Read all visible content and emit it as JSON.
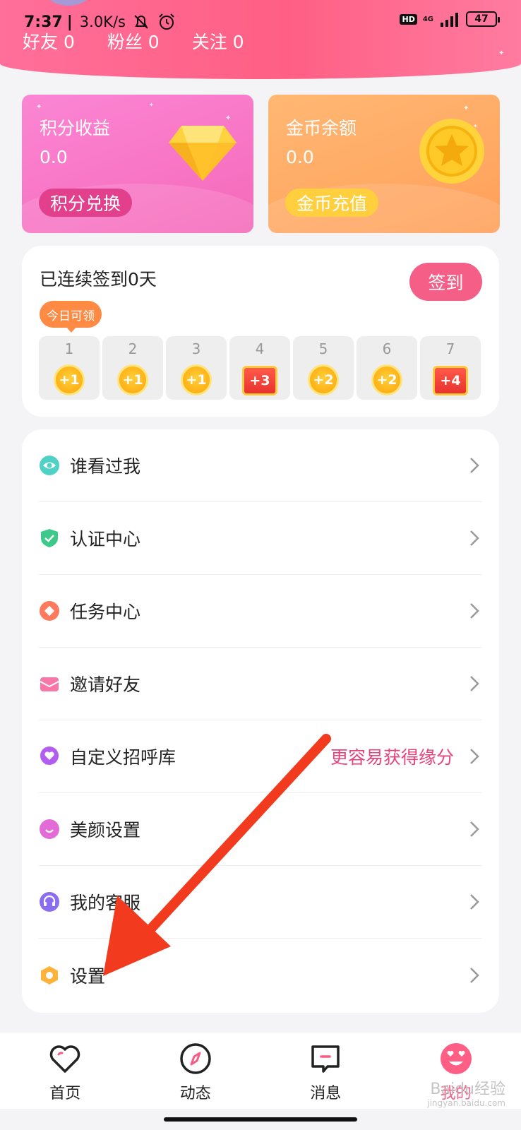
{
  "status_bar": {
    "time": "7:37",
    "net_speed": "3.0K/s",
    "hd": "HD",
    "network": "4G",
    "battery": "47"
  },
  "stats": [
    {
      "label": "好友 0"
    },
    {
      "label": "粉丝 0"
    },
    {
      "label": "关注 0"
    }
  ],
  "cards": {
    "points": {
      "title": "积分收益",
      "value": "0.0",
      "action": "积分兑换",
      "icon": "diamond-icon"
    },
    "coins": {
      "title": "金币余额",
      "value": "0.0",
      "action": "金币充值",
      "icon": "gold-coin-icon"
    }
  },
  "signin": {
    "streak_label": "已连续签到0天",
    "button": "签到",
    "today_tip": "今日可领",
    "days": [
      {
        "day": "1",
        "reward": "+1",
        "type": "coin"
      },
      {
        "day": "2",
        "reward": "+1",
        "type": "coin"
      },
      {
        "day": "3",
        "reward": "+1",
        "type": "coin"
      },
      {
        "day": "4",
        "reward": "+3",
        "type": "chest"
      },
      {
        "day": "5",
        "reward": "+2",
        "type": "coin"
      },
      {
        "day": "6",
        "reward": "+2",
        "type": "coin"
      },
      {
        "day": "7",
        "reward": "+4",
        "type": "chest"
      }
    ]
  },
  "menu": [
    {
      "label": "谁看过我",
      "icon": "eye-icon",
      "color": "#4fd1c5",
      "hint": ""
    },
    {
      "label": "认证中心",
      "icon": "shield-check-icon",
      "color": "#3cc98a",
      "hint": ""
    },
    {
      "label": "任务中心",
      "icon": "task-diamond-icon",
      "color": "#ff7a5c",
      "hint": ""
    },
    {
      "label": "邀请好友",
      "icon": "envelope-icon",
      "color": "#f977a8",
      "hint": ""
    },
    {
      "label": "自定义招呼库",
      "icon": "heart-bubble-icon",
      "color": "#b25cf0",
      "hint": "更容易获得缘分"
    },
    {
      "label": "美颜设置",
      "icon": "beauty-smile-icon",
      "color": "#e36bd8",
      "hint": ""
    },
    {
      "label": "我的客服",
      "icon": "headset-icon",
      "color": "#8a6ef0",
      "hint": ""
    },
    {
      "label": "设置",
      "icon": "gear-hexagon-icon",
      "color": "#ffb23a",
      "hint": ""
    }
  ],
  "tabs": [
    {
      "label": "首页",
      "icon": "heart-outline-icon"
    },
    {
      "label": "动态",
      "icon": "compass-icon"
    },
    {
      "label": "消息",
      "icon": "message-icon"
    },
    {
      "label": "我的",
      "icon": "smiley-love-icon"
    }
  ],
  "watermark": {
    "brand": "Baidu经验",
    "url": "jingyan.baidu.com"
  },
  "colors": {
    "header": "#ff5f84",
    "accent": "#f55e86",
    "points_card": "#f569b9",
    "coins_card": "#ff9f5a",
    "arrow": "#f23a1e"
  }
}
